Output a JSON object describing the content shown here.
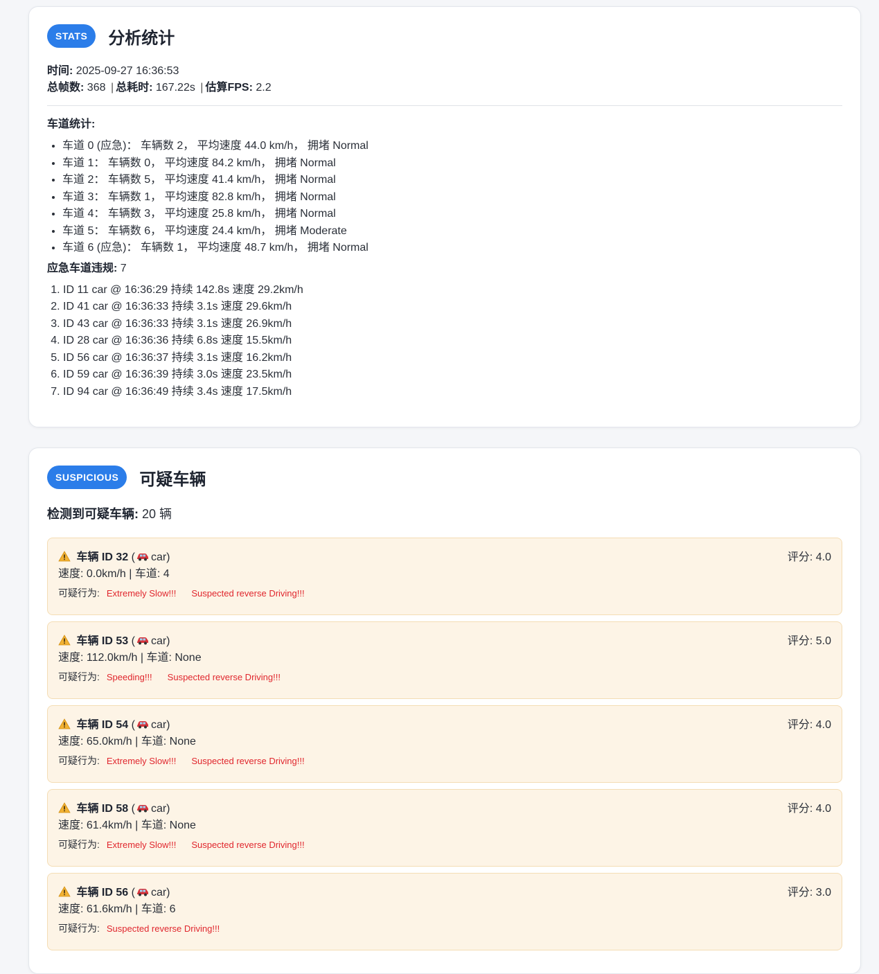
{
  "stats": {
    "tag": "STATS",
    "title": "分析统计",
    "time_label": "时间:",
    "time_value": "2025-09-27 16:36:53",
    "frames_label": "总帧数:",
    "frames_value": "368",
    "duration_label": "总耗时:",
    "duration_value": "167.22s",
    "fps_label": "估算FPS:",
    "fps_value": "2.2",
    "lane_stats_label": "车道统计:",
    "lanes": [
      "车道 0 (应急)： 车辆数 2， 平均速度 44.0 km/h， 拥堵 Normal",
      "车道 1： 车辆数 0， 平均速度 84.2 km/h， 拥堵 Normal",
      "车道 2： 车辆数 5， 平均速度 41.4 km/h， 拥堵 Normal",
      "车道 3： 车辆数 1， 平均速度 82.8 km/h， 拥堵 Normal",
      "车道 4： 车辆数 3， 平均速度 25.8 km/h， 拥堵 Normal",
      "车道 5： 车辆数 6， 平均速度 24.4 km/h， 拥堵 Moderate",
      "车道 6 (应急)： 车辆数 1， 平均速度 48.7 km/h， 拥堵 Normal"
    ],
    "violations_label": "应急车道违规:",
    "violations_count": "7",
    "violations": [
      "ID 11 car @ 16:36:29 持续 142.8s 速度 29.2km/h",
      "ID 41 car @ 16:36:33 持续 3.1s 速度 29.6km/h",
      "ID 43 car @ 16:36:33 持续 3.1s 速度 26.9km/h",
      "ID 28 car @ 16:36:36 持续 6.8s 速度 15.5km/h",
      "ID 56 car @ 16:36:37 持续 3.1s 速度 16.2km/h",
      "ID 59 car @ 16:36:39 持续 3.0s 速度 23.5km/h",
      "ID 94 car @ 16:36:49 持续 3.4s 速度 17.5km/h"
    ]
  },
  "suspicious": {
    "tag": "SUSPICIOUS",
    "title": "可疑车辆",
    "detected_label": "检测到可疑车辆:",
    "detected_value": "20 辆",
    "behaviors_label": "可疑行为:",
    "vehicles": [
      {
        "title": "车辆 ID 32",
        "type": "car",
        "score": "评分: 4.0",
        "info": "速度: 0.0km/h | 车道: 4",
        "behaviors": [
          "Extremely Slow!!!",
          "Suspected reverse Driving!!!"
        ]
      },
      {
        "title": "车辆 ID 53",
        "type": "car",
        "score": "评分: 5.0",
        "info": "速度: 112.0km/h | 车道: None",
        "behaviors": [
          "Speeding!!!",
          "Suspected reverse Driving!!!"
        ]
      },
      {
        "title": "车辆 ID 54",
        "type": "car",
        "score": "评分: 4.0",
        "info": "速度: 65.0km/h | 车道: None",
        "behaviors": [
          "Extremely Slow!!!",
          "Suspected reverse Driving!!!"
        ]
      },
      {
        "title": "车辆 ID 58",
        "type": "car",
        "score": "评分: 4.0",
        "info": "速度: 61.4km/h | 车道: None",
        "behaviors": [
          "Extremely Slow!!!",
          "Suspected reverse Driving!!!"
        ]
      },
      {
        "title": "车辆 ID 56",
        "type": "car",
        "score": "评分: 3.0",
        "info": "速度: 61.6km/h | 车道: 6",
        "behaviors": [
          "Suspected reverse Driving!!!"
        ]
      }
    ]
  }
}
